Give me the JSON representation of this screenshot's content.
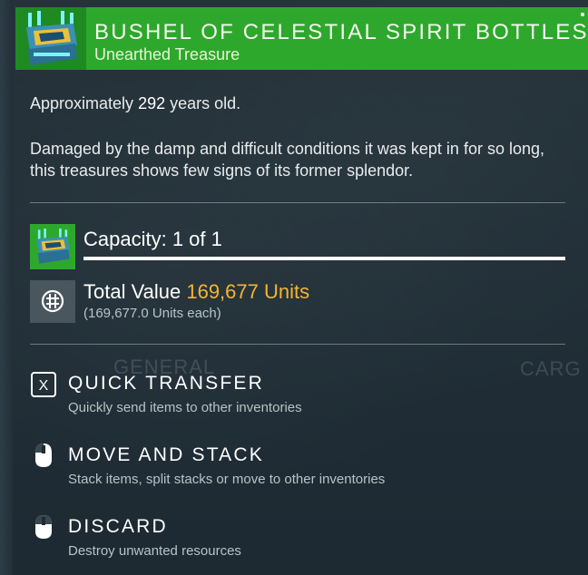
{
  "header": {
    "title": "BUSHEL OF CELESTIAL SPIRIT BOTTLES",
    "subtitle": "Unearthed Treasure",
    "icon": "treasure-crate-icon"
  },
  "description": {
    "age_prefix": "Approximately ",
    "age_value": "292",
    "age_suffix": " years old.",
    "text": "Damaged by the damp and difficult conditions it was kept in for so long, this treasures shows few signs of its former splendor."
  },
  "capacity": {
    "label": "Capacity: 1 of 1",
    "fill_fraction": 1.0
  },
  "value": {
    "label": "Total Value ",
    "units": "169,677 Units",
    "each": "(169,677.0 Units each)",
    "icon": "units-currency-icon",
    "units_color": "#f5b530"
  },
  "background_labels": {
    "general": "GENERAL",
    "cargo": "CARG"
  },
  "actions": [
    {
      "title": "QUICK TRANSFER",
      "desc": "Quickly send items to other inventories",
      "icon": "x-key-icon"
    },
    {
      "title": "MOVE AND STACK",
      "desc": "Stack items, split stacks or move to other inventories",
      "icon": "mouse-left-click-icon"
    },
    {
      "title": "DISCARD",
      "desc": "Destroy unwanted resources",
      "icon": "mouse-hold-icon"
    }
  ],
  "colors": {
    "header_green": "#2ea82c",
    "units_orange": "#f5b530"
  }
}
